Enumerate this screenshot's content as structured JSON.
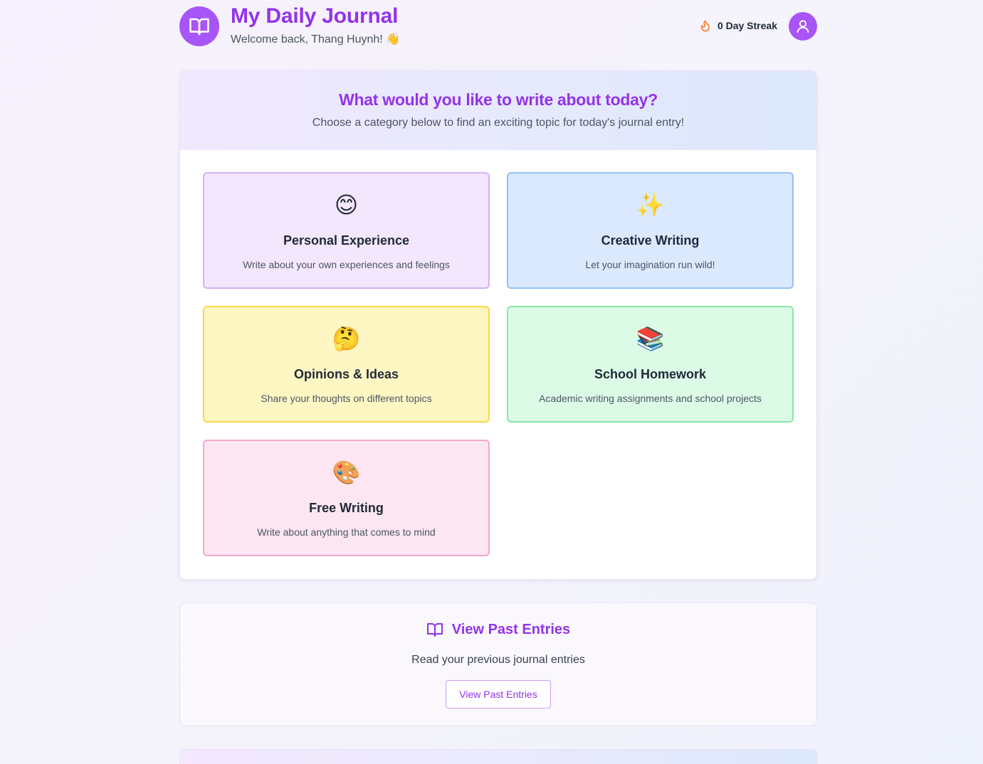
{
  "header": {
    "app_title": "My Daily Journal",
    "welcome": "Welcome back, Thang Huynh! 👋",
    "streak_label": "0 Day Streak"
  },
  "main": {
    "title": "What would you like to write about today?",
    "subtitle": "Choose a category below to find an exciting topic for today's journal entry!",
    "categories": [
      {
        "emoji": "😊",
        "title": "Personal Experience",
        "description": "Write about your own experiences and feelings",
        "color": "#f3e7fd"
      },
      {
        "emoji": "✨",
        "title": "Creative Writing",
        "description": "Let your imagination run wild!",
        "color": "#dbe9fe"
      },
      {
        "emoji": "🤔",
        "title": "Opinions & Ideas",
        "description": "Share your thoughts on different topics",
        "color": "#fef7c3"
      },
      {
        "emoji": "📚",
        "title": "School Homework",
        "description": "Academic writing assignments and school projects",
        "color": "#dcfbe7"
      },
      {
        "emoji": "🎨",
        "title": "Free Writing",
        "description": "Write about anything that comes to mind",
        "color": "#fce6f2"
      }
    ]
  },
  "past_entries": {
    "title": "View Past Entries",
    "subtitle": "Read your previous journal entries",
    "button_label": "View Past Entries"
  },
  "icons": {
    "logo": "book-open-icon",
    "streak": "flame-icon",
    "avatar": "user-icon",
    "past_entries": "book-open-icon"
  },
  "colors": {
    "accent": "#9333ea",
    "brand": "#a855f7",
    "flame": "#f97316"
  }
}
